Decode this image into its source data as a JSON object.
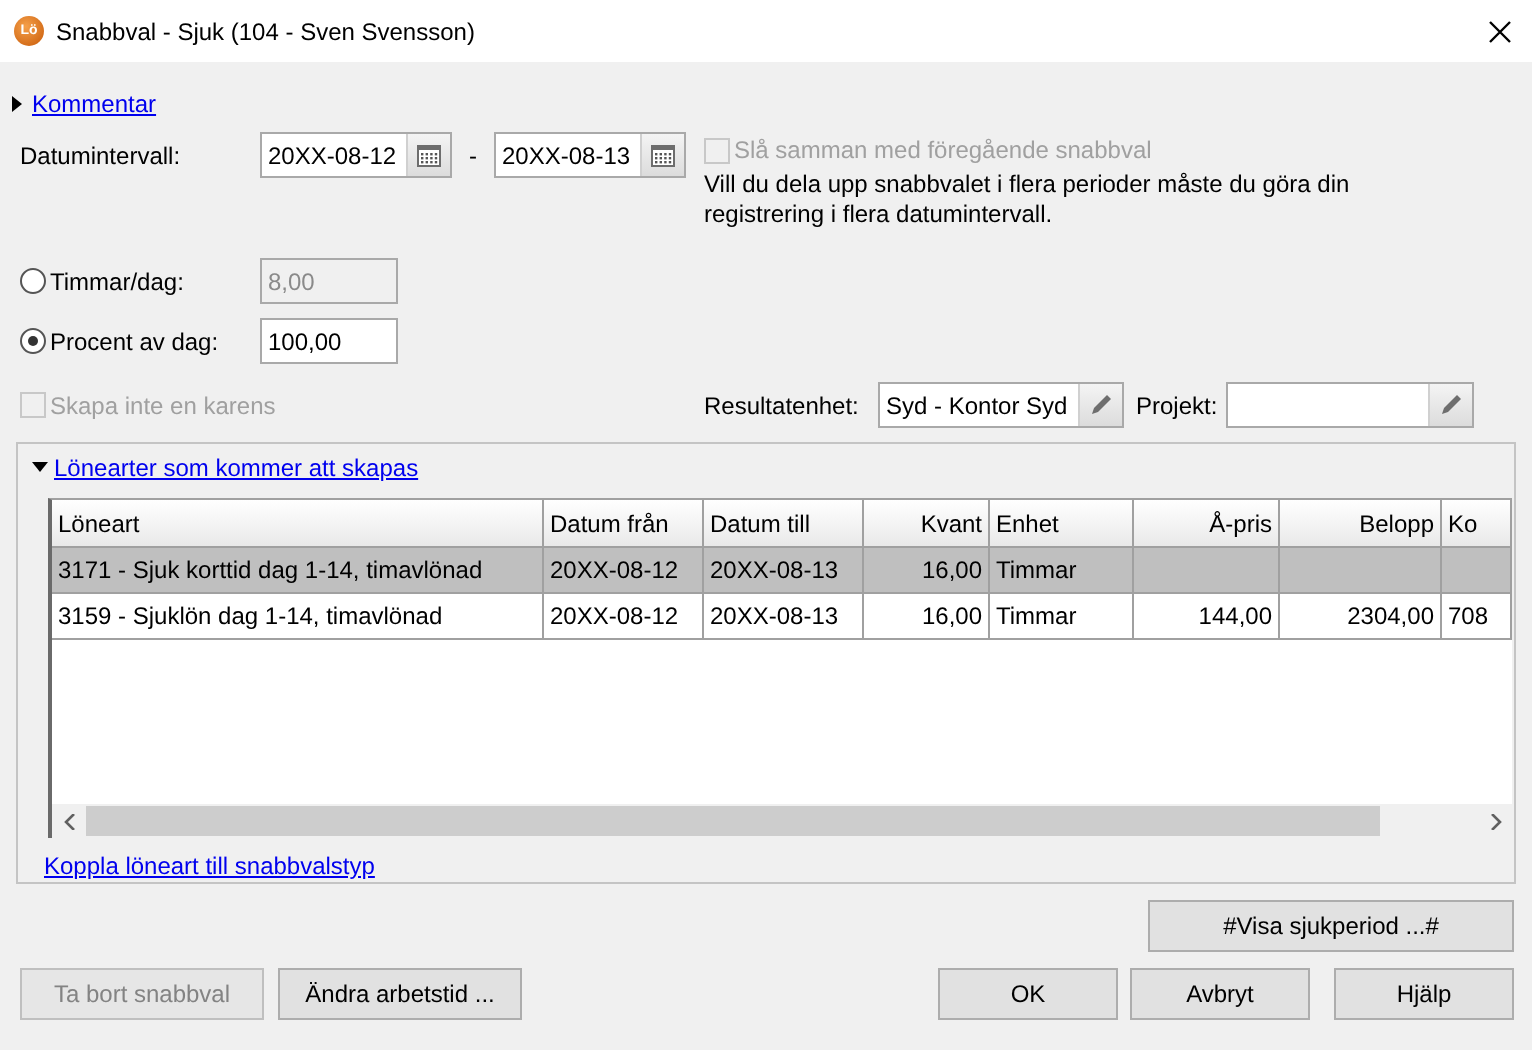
{
  "window": {
    "title": "Snabbval - Sjuk (104 - Sven Svensson)",
    "icon_label": "Lö"
  },
  "comment_section": {
    "label": "Kommentar",
    "expanded": false
  },
  "date_interval": {
    "label": "Datumintervall:",
    "from": "20XX-08-12",
    "separator": "-",
    "to": "20XX-08-13"
  },
  "merge_option": {
    "label": "Slå samman med föregående snabbval",
    "checked": false,
    "disabled": true
  },
  "info_text": "Vill du dela upp snabbvalet i flera perioder måste du göra din registrering i flera datumintervall.",
  "quantity_options": [
    {
      "label": "Timmar/dag:",
      "value": "8,00",
      "selected": false
    },
    {
      "label": "Procent av dag:",
      "value": "100,00",
      "selected": true
    }
  ],
  "karens_option": {
    "label": "Skapa inte en karens",
    "checked": false,
    "disabled": true
  },
  "result_unit": {
    "label": "Resultatenhet:",
    "value": "Syd - Kontor Syd"
  },
  "project": {
    "label": "Projekt:"
  },
  "salary_types": {
    "title": "Lönearter som kommer att skapas",
    "expanded": true,
    "columns": [
      {
        "label": "Löneart",
        "numeric": false
      },
      {
        "label": "Datum från",
        "numeric": false
      },
      {
        "label": "Datum till",
        "numeric": false
      },
      {
        "label": "Kvant",
        "numeric": true
      },
      {
        "label": "Enhet",
        "numeric": false
      },
      {
        "label": "Å-pris",
        "numeric": true
      },
      {
        "label": "Belopp",
        "numeric": true
      },
      {
        "label": "Ko",
        "numeric": false
      }
    ],
    "rows": [
      {
        "cells": [
          "3171 - Sjuk korttid dag 1-14, timavlönad",
          "20XX-08-12",
          "20XX-08-13",
          "16,00",
          "Timmar"
        ],
        "selected": true
      },
      {
        "cells": [
          "3159 - Sjuklön dag 1-14, timavlönad",
          "20XX-08-12",
          "20XX-08-13",
          "16,00",
          "Timmar",
          "144,00",
          "2304,00",
          "708"
        ],
        "selected": false
      }
    ],
    "link": "Koppla löneart till snabbvalstyp"
  },
  "sick_period_button": "#Visa sjukperiod ...#",
  "left_buttons": [
    {
      "label": "Ta bort snabbval",
      "disabled": true
    },
    {
      "label": "Ändra arbetstid ...",
      "disabled": false
    }
  ],
  "right_buttons": [
    {
      "label": "OK",
      "disabled": false
    },
    {
      "label": "Avbryt",
      "disabled": false
    },
    {
      "label": "Hjälp",
      "disabled": false
    }
  ]
}
